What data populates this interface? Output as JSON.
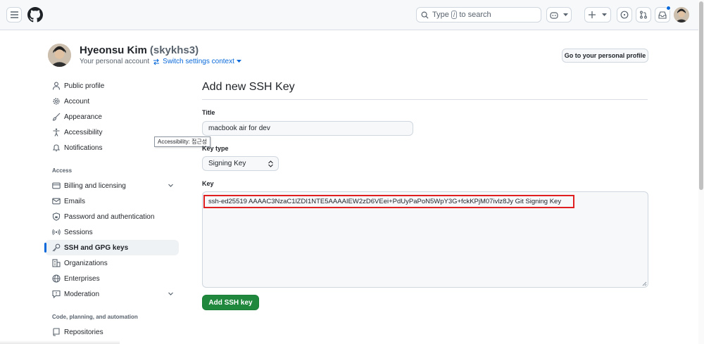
{
  "header": {
    "search_prefix": "Type",
    "search_key": "/",
    "search_suffix": "to search"
  },
  "profile": {
    "name": "Hyeonsu Kim",
    "login": "(skykhs3)",
    "subtitle": "Your personal account",
    "switch_label": "Switch settings context",
    "go_profile_label": "Go to your personal profile"
  },
  "sidebar": {
    "items": [
      {
        "label": "Public profile",
        "icon": "person-icon"
      },
      {
        "label": "Account",
        "icon": "gear-icon"
      },
      {
        "label": "Appearance",
        "icon": "paintbrush-icon"
      },
      {
        "label": "Accessibility",
        "icon": "accessibility-icon"
      },
      {
        "label": "Notifications",
        "icon": "bell-icon"
      }
    ],
    "access_heading": "Access",
    "access_items": [
      {
        "label": "Billing and licensing",
        "icon": "credit-card-icon"
      },
      {
        "label": "Emails",
        "icon": "mail-icon"
      },
      {
        "label": "Password and authentication",
        "icon": "shield-lock-icon"
      },
      {
        "label": "Sessions",
        "icon": "broadcast-icon"
      },
      {
        "label": "SSH and GPG keys",
        "icon": "key-icon"
      },
      {
        "label": "Organizations",
        "icon": "organization-icon"
      },
      {
        "label": "Enterprises",
        "icon": "globe-icon"
      },
      {
        "label": "Moderation",
        "icon": "report-icon"
      }
    ],
    "code_heading": "Code, planning, and automation",
    "code_items": [
      {
        "label": "Repositories",
        "icon": "repo-icon"
      }
    ],
    "tooltip": "Accessibility: 접근성"
  },
  "form": {
    "page_title": "Add new SSH Key",
    "title_label": "Title",
    "title_value": "macbook air for dev",
    "keytype_label": "Key type",
    "keytype_value": "Signing Key",
    "key_label": "Key",
    "key_value": "ssh-ed25519 AAAAC3NzaC1lZDI1NTE5AAAAIEW2zD6VEei+PdUyPaPoN5WpY3G+fckKPjM07ivlz8Jy Git Signing Key",
    "submit_label": "Add SSH key"
  },
  "colors": {
    "accent": "#0969da",
    "primary_button": "#1f883d",
    "highlight_box": "#e02020"
  }
}
